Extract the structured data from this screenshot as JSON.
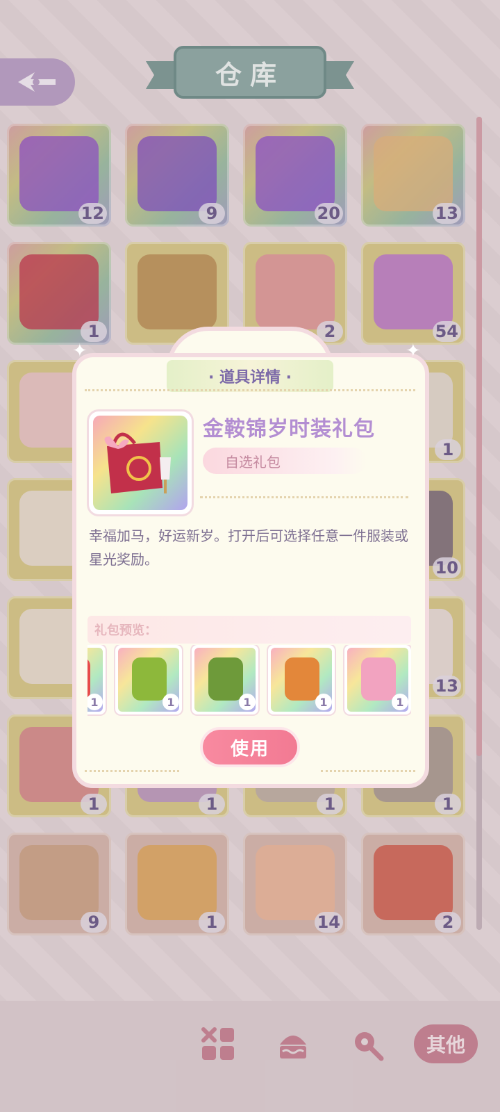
{
  "header": {
    "title": "仓库"
  },
  "grid": {
    "items": [
      {
        "name": "fireworks-purple-1",
        "count": "12",
        "style": "rainbow",
        "color": "#8f4ecb"
      },
      {
        "name": "fireworks-purple-2",
        "count": "9",
        "style": "rainbow",
        "color": "#7f4cc6"
      },
      {
        "name": "fireworks-purple-3",
        "count": "20",
        "style": "rainbow",
        "color": "#8d4fd0"
      },
      {
        "name": "snack-packs",
        "count": "13",
        "style": "rainbow",
        "color": "#e5b77c"
      },
      {
        "name": "red-gift-bag",
        "count": "1",
        "style": "rainbow",
        "color": "#c2304a"
      },
      {
        "name": "grocery-bag-brown",
        "count": "",
        "style": "yellow",
        "color": "#b7854e"
      },
      {
        "name": "grocery-bag-pink",
        "count": "2",
        "style": "yellow",
        "color": "#e38da0"
      },
      {
        "name": "purple-gem",
        "count": "54",
        "style": "yellow",
        "color": "#b86bd8"
      },
      {
        "name": "pink-box",
        "count": "",
        "style": "yellow",
        "color": "#efc6d7"
      },
      {
        "name": "hidden-2",
        "count": "",
        "style": "yellow",
        "color": "#d8c988"
      },
      {
        "name": "hidden-3",
        "count": "",
        "style": "yellow",
        "color": "#d8c988"
      },
      {
        "name": "ticket",
        "count": "1",
        "style": "yellow",
        "color": "#e7dfe4"
      },
      {
        "name": "sticker-sheet-1",
        "count": "",
        "style": "yellow",
        "color": "#efe3e4"
      },
      {
        "name": "hidden-4",
        "count": "",
        "style": "yellow",
        "color": "#d8c988"
      },
      {
        "name": "hidden-5",
        "count": "",
        "style": "yellow",
        "color": "#d8c988"
      },
      {
        "name": "dark-bow",
        "count": "10",
        "style": "yellow",
        "color": "#6a5a7a"
      },
      {
        "name": "sticker-sheet-2",
        "count": "",
        "style": "yellow",
        "color": "#efe3e4"
      },
      {
        "name": "hidden-6",
        "count": "",
        "style": "yellow",
        "color": "#d8c988"
      },
      {
        "name": "hidden-7",
        "count": "",
        "style": "yellow",
        "color": "#d8c988"
      },
      {
        "name": "card",
        "count": "13",
        "style": "yellow",
        "color": "#ece2ef"
      },
      {
        "name": "badge",
        "count": "1",
        "style": "yellow",
        "color": "#d77b8e"
      },
      {
        "name": "candies",
        "count": "1",
        "style": "yellow",
        "color": "#b48cd0"
      },
      {
        "name": "photo-card-1",
        "count": "1",
        "style": "yellow",
        "color": "#b8a8ae"
      },
      {
        "name": "photo-card-2",
        "count": "1",
        "style": "yellow",
        "color": "#9e8f97"
      },
      {
        "name": "parfait",
        "count": "9",
        "style": "pink",
        "color": "#c9a07c"
      },
      {
        "name": "fries",
        "count": "1",
        "style": "pink",
        "color": "#e0a64f"
      },
      {
        "name": "ice-cream",
        "count": "14",
        "style": "pink",
        "color": "#f0b896"
      },
      {
        "name": "gift-cake",
        "count": "2",
        "style": "pink",
        "color": "#d0503e"
      }
    ]
  },
  "popup": {
    "title": "· 道具详情 ·",
    "item_name": "金鞍锦岁时装礼包",
    "tag": "自选礼包",
    "description": "幸福加马，好运新岁。打开后可选择任意一件服装或星光奖励。",
    "preview_label": "礼包预览：",
    "preview_items": [
      {
        "name": "red-outfit",
        "count": "1",
        "color": "#e74b4b"
      },
      {
        "name": "green-dress",
        "count": "1",
        "color": "#8db83b"
      },
      {
        "name": "green-overalls",
        "count": "1",
        "color": "#6e9a3a"
      },
      {
        "name": "fox-costume",
        "count": "1",
        "color": "#e3873a"
      },
      {
        "name": "pink-dress",
        "count": "1",
        "color": "#f2a3c0"
      }
    ],
    "use_button": "使用"
  },
  "bottom_tabs": {
    "active_label": "其他"
  },
  "colors": {
    "accent": "#f27a93",
    "text_purple": "#b38ed2",
    "count_text": "#6a5a8a"
  }
}
